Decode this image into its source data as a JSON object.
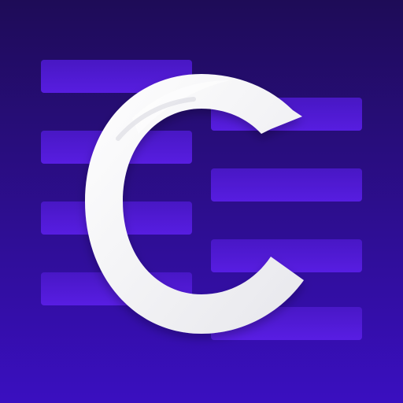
{
  "app_icon": {
    "logo_letter": "C",
    "icon_name": "c-logo-icon",
    "colors": {
      "background_top": "#1e0c57",
      "background_bottom": "#3a0fc0",
      "bar_top": "#4a18c8",
      "bar_bottom": "#5a1ee6",
      "logo_light": "#ffffff",
      "logo_shade": "#e7e7ec"
    }
  }
}
